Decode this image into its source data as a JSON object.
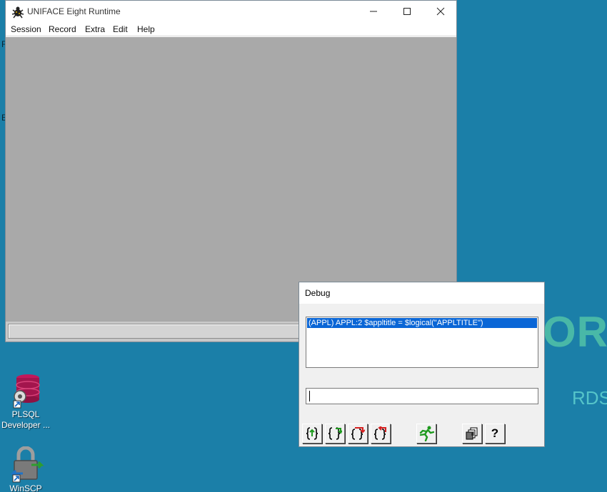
{
  "desktop": {
    "brand_text": "ORI",
    "sub_text": "RDS",
    "frag_1": "F",
    "frag_2": "E",
    "icons": [
      {
        "name": "PLSQL Developer",
        "label_1": "PLSQL",
        "label_2": "Developer ..."
      },
      {
        "name": "WinSCP",
        "label_1": "WinSCP"
      }
    ]
  },
  "uniface_window": {
    "title": "UNIFACE Eight Runtime",
    "menu": [
      "Session",
      "Record",
      "Extra",
      "Edit",
      "Help"
    ]
  },
  "debug_window": {
    "title": "Debug",
    "list_selected": "(APPL) APPL:2  $appltitle = $logical(\"APPLTITLE\")",
    "input_value": "",
    "toolbar": [
      "step-into-icon",
      "step-over-icon",
      "step-out-icon",
      "return-icon",
      "run-icon",
      "stack-icon",
      "help-icon"
    ],
    "help_glyph": "?"
  },
  "colors": {
    "desktop": "#1b7fa8",
    "client_area": "#a9a9a9",
    "selection": "#0a66d6",
    "brand": "#49b8a7"
  }
}
